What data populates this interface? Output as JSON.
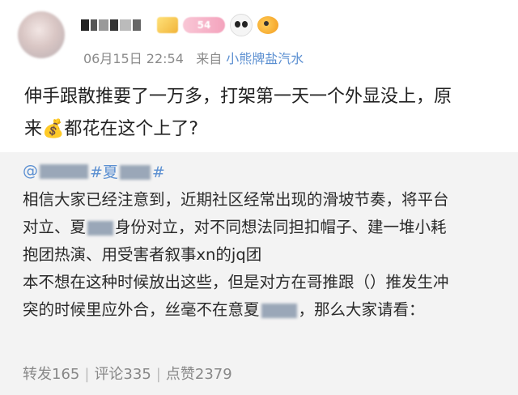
{
  "post": {
    "author": {
      "level_badge": "54",
      "badges": [
        "vip-badge",
        "panda-badge",
        "fish-badge"
      ]
    },
    "date": "06月15日 22:54",
    "source_prefix": "来自",
    "source": "小熊牌盐汽水",
    "text_line1": "伸手跟散推要了一万多，打架第一天一个外显没上，原",
    "text_line2_pre": "来",
    "text_line2_post": "都花在这个上了?",
    "emoji": "💰"
  },
  "repost": {
    "author_visible": "@",
    "topic_prefix": "#夏",
    "topic_suffix": "#",
    "text_line1": "相信大家已经注意到，近期社区经常出现的滑坡节奏，将平台",
    "text_line2_pre": "对立、夏",
    "text_line2_post": "身份对立，对不同想法同担扣帽子、建一堆小耗",
    "text_line3": "抱团热演、用受害者叙事xn的jq团",
    "text_line4": "本不想在这种时候放出这些，但是对方在哥推跟（）推发生冲",
    "text_line5_pre": "突的时候里应外合，丝毫不在意夏",
    "text_line5_post": "，那么大家请看：",
    "stats": {
      "reposts": "转发165",
      "comments": "评论335",
      "likes": "点赞2379"
    }
  },
  "colors": {
    "link": "#5b8fd1",
    "meta": "#8a8a8a",
    "repost_bg": "#f3f3f3"
  }
}
